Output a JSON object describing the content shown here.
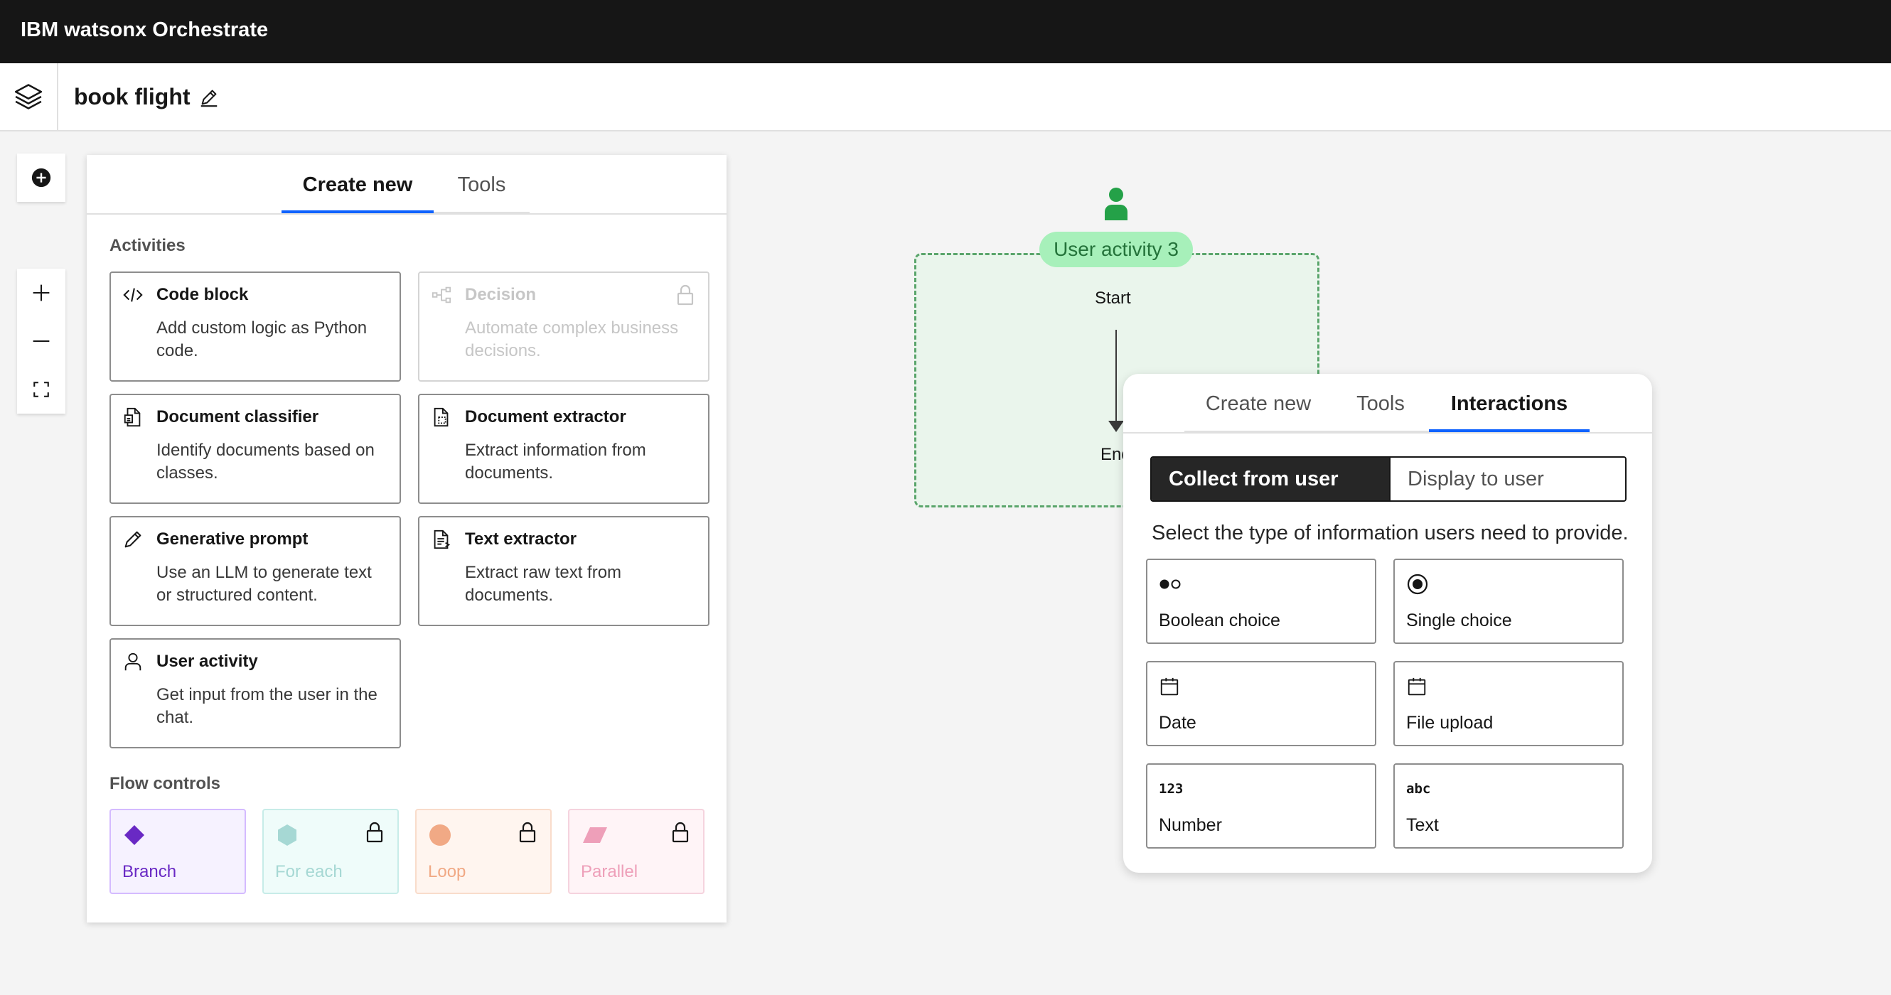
{
  "app": {
    "brand": "IBM watsonx Orchestrate"
  },
  "flow": {
    "title": "book flight"
  },
  "panel": {
    "tabs": [
      {
        "label": "Create new",
        "active": true
      },
      {
        "label": "Tools",
        "active": false
      }
    ],
    "activities_label": "Activities",
    "activities": [
      {
        "title": "Code block",
        "desc": "Add custom logic as Python code.",
        "icon": "code-icon",
        "locked": false
      },
      {
        "title": "Decision",
        "desc": "Automate complex business decisions.",
        "icon": "decision-icon",
        "locked": true
      },
      {
        "title": "Document classifier",
        "desc": "Identify documents based on classes.",
        "icon": "document-classifier-icon",
        "locked": false
      },
      {
        "title": "Document extractor",
        "desc": "Extract information from documents.",
        "icon": "document-extractor-icon",
        "locked": false
      },
      {
        "title": "Generative prompt",
        "desc": "Use an LLM to generate text or structured content.",
        "icon": "pencil-icon",
        "locked": false
      },
      {
        "title": "Text extractor",
        "desc": "Extract raw text from documents.",
        "icon": "text-extractor-icon",
        "locked": false
      },
      {
        "title": "User activity",
        "desc": "Get input from the user in the chat.",
        "icon": "user-icon",
        "locked": false
      }
    ],
    "flow_controls_label": "Flow controls",
    "flow_controls": [
      {
        "label": "Branch",
        "icon": "diamond-icon",
        "color": "#6929c4",
        "bg": "#f6f2ff",
        "border": "#d4bbff",
        "locked": false
      },
      {
        "label": "For each",
        "icon": "hexagon-icon",
        "color": "#a6d8d4",
        "bg": "#effcfa",
        "border": "#c7ece8",
        "locked": true
      },
      {
        "label": "Loop",
        "icon": "circle-icon",
        "color": "#f1a985",
        "bg": "#fff5ef",
        "border": "#f9dccb",
        "locked": true
      },
      {
        "label": "Parallel",
        "icon": "parallelogram-icon",
        "color": "#ee9fb9",
        "bg": "#fff4f7",
        "border": "#f5d3de",
        "locked": true
      }
    ]
  },
  "canvas": {
    "node_label": "User activity 3",
    "start_label": "Start",
    "end_label": "End",
    "node_color": "#24a148"
  },
  "popup": {
    "tabs": [
      {
        "label": "Create new",
        "active": false
      },
      {
        "label": "Tools",
        "active": false
      },
      {
        "label": "Interactions",
        "active": true
      }
    ],
    "segment": {
      "selected": "Collect from user",
      "other": "Display to user"
    },
    "prompt": "Select the type of information users need to provide.",
    "options": [
      {
        "label": "Boolean choice",
        "icon": "boolean-icon"
      },
      {
        "label": "Single choice",
        "icon": "radio-button-icon"
      },
      {
        "label": "Date",
        "icon": "calendar-icon"
      },
      {
        "label": "File upload",
        "icon": "calendar-icon"
      },
      {
        "label": "Number",
        "icon": "number-icon",
        "glyph": "123"
      },
      {
        "label": "Text",
        "icon": "text-icon",
        "glyph": "abc"
      }
    ]
  }
}
